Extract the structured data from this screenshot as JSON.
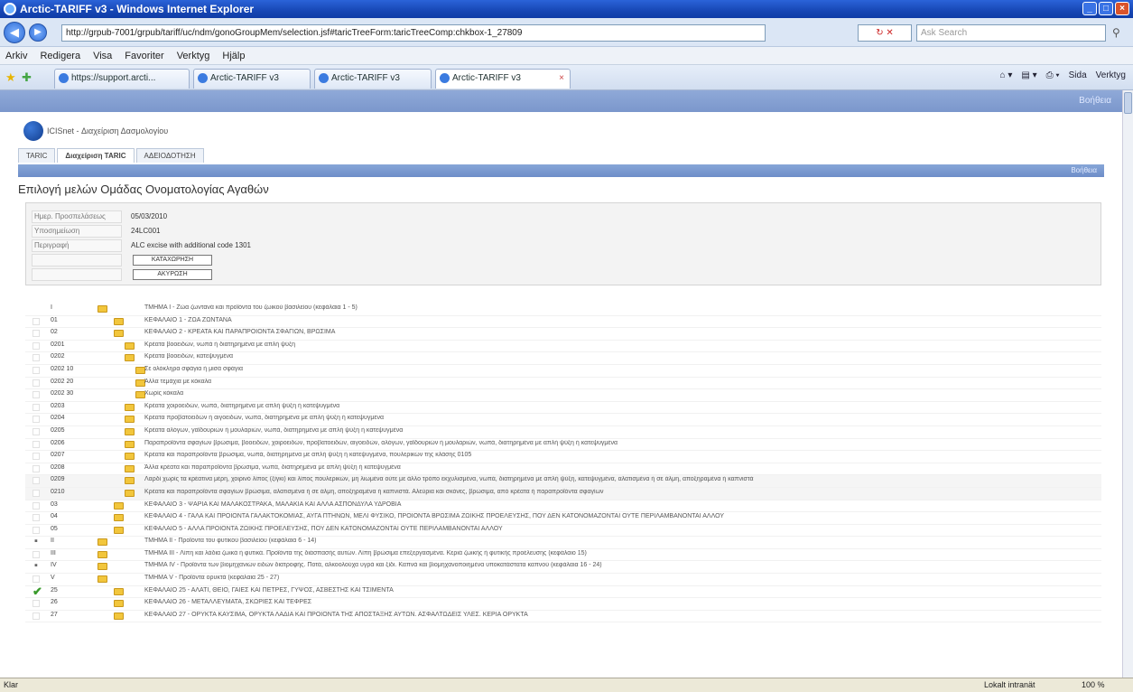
{
  "window": {
    "title": "Arctic-TARIFF v3 - Windows Internet Explorer"
  },
  "browser": {
    "url": "http://grpub-7001/grpub/tariff/uc/ndm/gonoGroupMem/selection.jsf#taricTreeForm:taricTreeComp:chkbox-1_27809",
    "search_placeholder": "Ask Search",
    "menu": [
      "Arkiv",
      "Redigera",
      "Visa",
      "Favoriter",
      "Verktyg",
      "Hjälp"
    ],
    "tabs": [
      {
        "label": "https://support.arcti..."
      },
      {
        "label": "Arctic-TARIFF v3"
      },
      {
        "label": "Arctic-TARIFF v3"
      },
      {
        "label": "Arctic-TARIFF v3"
      }
    ],
    "commands": [
      "Sida",
      "Verktyg"
    ]
  },
  "app": {
    "title": "ICISnet - Διαχείριση Δασμολογίου",
    "tabs": [
      {
        "label": "TARIC"
      },
      {
        "label": "Διαχείριση TARIC"
      },
      {
        "label": "ΑΔΕΙΟΔΟΤΗΣΗ"
      }
    ],
    "help_label": "Βοήθεια"
  },
  "page": {
    "title": "Επιλογή μελών Ομάδας Ονοματολογίας Αγαθών"
  },
  "form": {
    "date_label": "Ημερ. Προσπελάσεως",
    "date_value": "05/03/2010",
    "code_label": "Υποσημείωση",
    "code_value": "24LC001",
    "desc_label": "Περιγραφή",
    "desc_value": "ALC excise with additional code 1301",
    "save_label": "ΚΑΤΑΧΩΡΗΣΗ",
    "cancel_label": "ΑΚΥΡΩΣΗ"
  },
  "tree": [
    {
      "code": "I",
      "level": 0,
      "state": "none",
      "desc": "ΤΜΗΜΑ I - Ζώα ζωντανά και προϊόντα του ζωικού βασιλείου (κεφάλαια 1 - 5)"
    },
    {
      "code": "01",
      "level": 1,
      "state": "empty",
      "desc": "ΚΕΦΑΛΑΙΟ 1 - ΖΩΑ ΖΩΝΤΑΝΑ"
    },
    {
      "code": "02",
      "level": 1,
      "state": "empty",
      "desc": "ΚΕΦΑΛΑΙΟ 2 - ΚΡΕΑΤΑ ΚΑΙ ΠΑΡΑΠΡΟΙΟΝΤΑ ΣΦΑΓΙΩΝ, ΒΡΩΣΙΜΑ"
    },
    {
      "code": "0201",
      "level": 2,
      "state": "empty",
      "desc": "Κρέατα βοοειδών, νωπά ή διατηρημένα με απλή ψύξη"
    },
    {
      "code": "0202",
      "level": 2,
      "state": "empty",
      "desc": "Κρέατα βοοειδών, κατεψυγμένα"
    },
    {
      "code": "0202 10",
      "level": 3,
      "state": "empty",
      "desc": "Σε ολόκληρα σφάγια ή μισά σφάγια"
    },
    {
      "code": "0202 20",
      "level": 3,
      "state": "empty",
      "desc": "Άλλα τεμάχια με κόκαλα"
    },
    {
      "code": "0202 30",
      "level": 3,
      "state": "empty",
      "desc": "Χωρίς κόκαλα"
    },
    {
      "code": "0203",
      "level": 2,
      "state": "empty",
      "desc": "Κρέατα χοιροειδών, νωπά, διατηρημένα με απλή ψύξη ή κατεψυγμένα"
    },
    {
      "code": "0204",
      "level": 2,
      "state": "empty",
      "desc": "Κρέατα προβατοειδών ή αιγοειδών, νωπά, διατηρημένα με απλή ψύξη ή κατεψυγμένα"
    },
    {
      "code": "0205",
      "level": 2,
      "state": "empty",
      "desc": "Κρέατα αλόγων, γαϊδουριών ή μουλαριών, νωπά, διατηρημένα με απλή ψύξη ή κατεψυγμένα"
    },
    {
      "code": "0206",
      "level": 2,
      "state": "empty",
      "desc": "Παραπροϊόντα σφαγίων βρώσιμα, βοοειδών, χοιροειδών, προβατοειδών, αιγοειδών, αλόγων, γαϊδουριών ή μουλαριών, νωπά, διατηρημένα με απλή ψύξη ή κατεψυγμένα"
    },
    {
      "code": "0207",
      "level": 2,
      "state": "empty",
      "desc": "Κρέατα και παραπροϊόντα βρώσιμα, νωπά, διατηρημένα με απλή ψύξη ή κατεψυγμένα, πουλερικών της κλάσης 0105"
    },
    {
      "code": "0208",
      "level": 2,
      "state": "empty",
      "desc": "Άλλα κρέατα και παραπροϊόντα βρώσιμα, νωπά, διατηρημένα με απλή ψύξη ή κατεψυγμένα"
    },
    {
      "code": "0209",
      "level": 2,
      "state": "empty",
      "desc": "Λαρδί χωρίς τα κρέατινα μέρη, χοιρινό λίπος (ξίγκι) και λίπος πουλερικών, μη λιωμένα ούτε με άλλο τρόπο εκχυλισμένα, νωπά, διατηρημένα με απλή ψύξη, κατεψυγμένα, αλατισμένα ή σε άλμη, αποξηραμένα ή καπνιστά"
    },
    {
      "code": "0210",
      "level": 2,
      "state": "empty",
      "desc": "Κρέατα και παραπροϊόντα σφαγίων βρώσιμα, αλατισμένα ή σε άλμη, αποξηραμένα ή καπνιστά. Αλεύρια και σκόνες, βρώσιμα, από κρέατα ή παραπροϊόντα σφαγίων"
    },
    {
      "code": "03",
      "level": 1,
      "state": "empty",
      "desc": "ΚΕΦΑΛΑΙΟ 3 - ΨΑΡΙΑ ΚΑΙ ΜΑΛΑΚΟΣΤΡΑΚΑ, ΜΑΛΑΚΙΑ ΚΑΙ ΑΛΛΑ ΑΣΠΟΝΔΥΛΑ ΥΔΡΟΒΙΑ"
    },
    {
      "code": "04",
      "level": 1,
      "state": "empty",
      "desc": "ΚΕΦΑΛΑΙΟ 4 - ΓΑΛΑ ΚΑΙ ΠΡΟΙΟΝΤΑ ΓΑΛΑΚΤΟΚΟΜΙΑΣ, ΑΥΓΑ ΠΤΗΝΩΝ, ΜΕΛΙ ΦΥΣΙΚΟ, ΠΡΟΙΟΝΤΑ ΒΡΩΣΙΜΑ ΖΩΙΚΗΣ ΠΡΟΕΛΕΥΣΗΣ, ΠΟΥ ΔΕΝ ΚΑΤΟΝΟΜΑΖΟΝΤΑΙ ΟΥΤΕ ΠΕΡΙΛΑΜΒΑΝΟΝΤΑΙ ΑΛΛΟΥ"
    },
    {
      "code": "05",
      "level": 1,
      "state": "empty",
      "desc": "ΚΕΦΑΛΑΙΟ 5 - ΑΛΛΑ ΠΡΟΙΟΝΤΑ ΖΩΙΚΗΣ ΠΡΟΕΛΕΥΣΗΣ, ΠΟΥ ΔΕΝ ΚΑΤΟΝΟΜΑΖΟΝΤΑΙ ΟΥΤΕ ΠΕΡΙΛΑΜΒΑΝΟΝΤΑΙ ΑΛΛΟΥ"
    },
    {
      "code": "II",
      "level": 0,
      "state": "partial",
      "desc": "ΤΜΗΜΑ II - Προϊόντα του φυτικού βασιλείου (κεφάλαια 6 - 14)"
    },
    {
      "code": "III",
      "level": 0,
      "state": "empty",
      "desc": "ΤΜΗΜΑ III - Λίπη και λάδια ζωικά ή φυτικά. Προϊόντα της διάσπασής αυτών. Λίπη βρώσιμα επεξεργασμένα. Κεριά ζωικής ή φυτικής προέλευσης (κεφάλαιο 15)"
    },
    {
      "code": "IV",
      "level": 0,
      "state": "partial",
      "desc": "ΤΜΗΜΑ IV - Προϊόντα των βιομηχανιών ειδών διατροφής. Ποτά, αλκοολούχα υγρά και ξίδι. Καπνά και βιομηχανοποιημένα υποκατάστατα καπνού (κεφάλαια 16 - 24)"
    },
    {
      "code": "V",
      "level": 0,
      "state": "empty",
      "desc": "ΤΜΗΜΑ V - Προϊόντα ορυκτά (κεφάλαια 25 - 27)"
    },
    {
      "code": "25",
      "level": 1,
      "state": "checked",
      "desc": "ΚΕΦΑΛΑΙΟ 25 - ΑΛΑΤΙ, ΘΕΙΟ, ΓΑΙΕΣ ΚΑΙ ΠΕΤΡΕΣ, ΓΥΨΟΣ, ΑΣΒΕΣΤΗΣ ΚΑΙ ΤΣΙΜΕΝΤΑ"
    },
    {
      "code": "26",
      "level": 1,
      "state": "empty",
      "desc": "ΚΕΦΑΛΑΙΟ 26 - ΜΕΤΑΛΛΕΥΜΑΤΑ, ΣΚΩΡΙΕΣ ΚΑΙ ΤΕΦΡΕΣ"
    },
    {
      "code": "27",
      "level": 1,
      "state": "empty",
      "desc": "ΚΕΦΑΛΑΙΟ 27 - ΟΡΥΚΤΑ ΚΑΥΣΙΜΑ, ΟΡΥΚΤΑ ΛΑΔΙΑ ΚΑΙ ΠΡΟΙΟΝΤΑ ΤΗΣ ΑΠΟΣΤΑΞΗΣ ΑΥΤΩΝ. ΑΣΦΑΛΤΩΔΕΙΣ ΥΛΕΣ. ΚΕΡΙΑ ΟΡΥΚΤΑ"
    }
  ],
  "status": {
    "left": "Klar",
    "zone": "Lokalt intranät",
    "zoom": "100 %"
  },
  "colors": {
    "titlebar": "#1747b5",
    "folder": "#f2c63c",
    "check": "#3a9b2c",
    "bluebar": "#7b97cc"
  }
}
